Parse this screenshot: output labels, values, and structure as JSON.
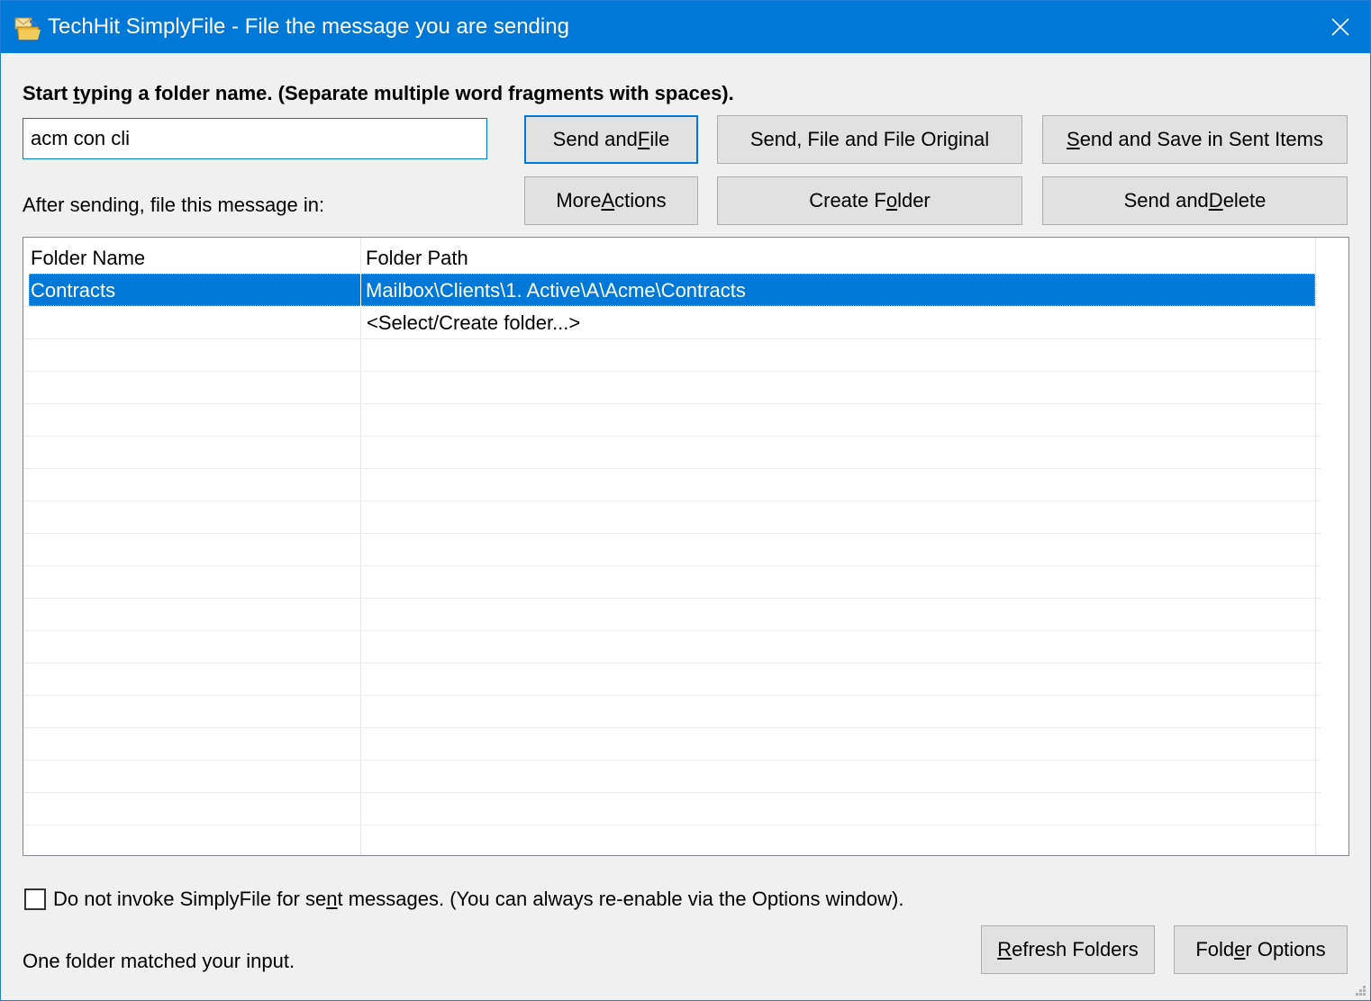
{
  "window": {
    "title": "TechHit SimplyFile - File the message you are sending",
    "app_icon": "envelope-folder-icon",
    "close_icon": "close-icon",
    "accent_color": "#0078d7"
  },
  "search": {
    "instruction_pre": "Start ",
    "instruction_access": "t",
    "instruction_post": "yping a folder name. (Separate multiple word fragments with spaces).",
    "value": "acm con cli",
    "placeholder": ""
  },
  "after_label": "After sending, file this message in:",
  "buttons": {
    "send_and_file": {
      "pre": "Send and ",
      "key": "F",
      "post": "ile"
    },
    "send_file_original": {
      "pre": "Send, File and File Ori",
      "key": "g",
      "post": "inal"
    },
    "send_save_sent": {
      "pre": "",
      "key": "S",
      "post": "end and Save in Sent Items"
    },
    "more_actions": {
      "pre": "More ",
      "key": "A",
      "post": "ctions"
    },
    "create_folder": {
      "pre": "Create F",
      "key": "o",
      "post": "lder"
    },
    "send_and_delete": {
      "pre": "Send and ",
      "key": "D",
      "post": "elete"
    },
    "refresh_folders": {
      "pre": "",
      "key": "R",
      "post": "efresh Folders"
    },
    "folder_options": {
      "pre": "Fold",
      "key": "e",
      "post": "r Options"
    }
  },
  "folder_list": {
    "columns": [
      "Folder Name",
      "Folder Path"
    ],
    "rows": [
      {
        "name": "Contracts",
        "path": "Mailbox\\Clients\\1. Active\\A\\Acme\\Contracts",
        "selected": true
      },
      {
        "name": "",
        "path": "<Select/Create folder...>",
        "selected": false
      }
    ]
  },
  "checkbox": {
    "checked": false,
    "label_pre": "Do not invoke SimplyFile for se",
    "label_key": "n",
    "label_post": "t messages. (You can always re-enable via the Options window)."
  },
  "status": "One folder matched your input."
}
